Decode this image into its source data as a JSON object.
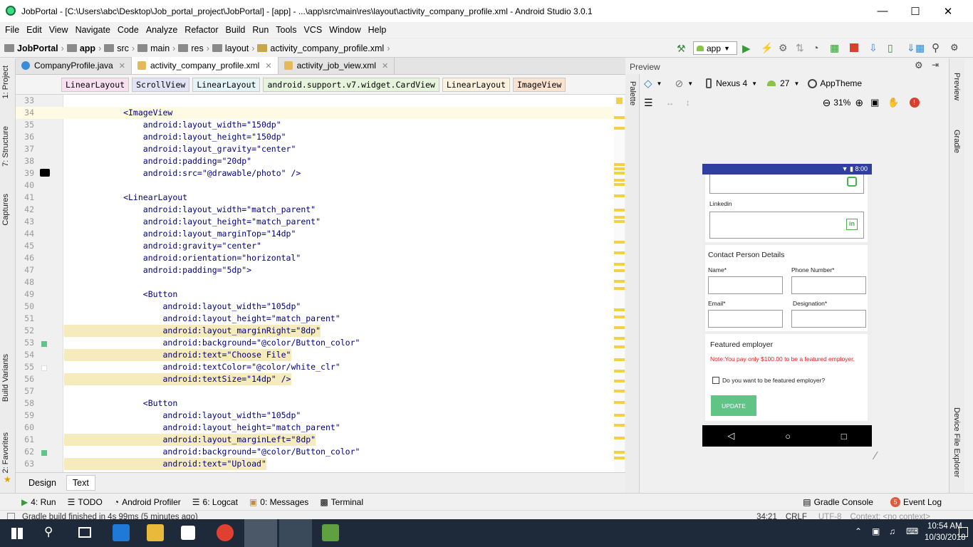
{
  "window": {
    "title": "JobPortal - [C:\\Users\\abc\\Desktop\\Job_portal_project\\JobPortal] - [app] - ...\\app\\src\\main\\res\\layout\\activity_company_profile.xml - Android Studio 3.0.1"
  },
  "menu": [
    "File",
    "Edit",
    "View",
    "Navigate",
    "Code",
    "Analyze",
    "Refactor",
    "Build",
    "Run",
    "Tools",
    "VCS",
    "Window",
    "Help"
  ],
  "breadcrumbs": [
    "JobPortal",
    "app",
    "src",
    "main",
    "res",
    "layout",
    "activity_company_profile.xml"
  ],
  "run_config": "app",
  "tabs": [
    {
      "label": "CompanyProfile.java"
    },
    {
      "label": "activity_company_profile.xml"
    },
    {
      "label": "activity_job_view.xml"
    }
  ],
  "component_path": [
    "LinearLayout",
    "ScrollView",
    "LinearLayout",
    "android.support.v7.widget.CardView",
    "LinearLayout",
    "ImageView"
  ],
  "code_lines": [
    {
      "n": "33",
      "text": ""
    },
    {
      "n": "34",
      "text": "            <ImageView"
    },
    {
      "n": "35",
      "text": "                android:layout_width=\"150dp\""
    },
    {
      "n": "36",
      "text": "                android:layout_height=\"150dp\""
    },
    {
      "n": "37",
      "text": "                android:layout_gravity=\"center\""
    },
    {
      "n": "38",
      "text": "                android:padding=\"20dp\""
    },
    {
      "n": "39",
      "text": "                android:src=\"@drawable/photo\" />"
    },
    {
      "n": "40",
      "text": ""
    },
    {
      "n": "41",
      "text": "            <LinearLayout"
    },
    {
      "n": "42",
      "text": "                android:layout_width=\"match_parent\""
    },
    {
      "n": "43",
      "text": "                android:layout_height=\"match_parent\""
    },
    {
      "n": "44",
      "text": "                android:layout_marginTop=\"14dp\""
    },
    {
      "n": "45",
      "text": "                android:gravity=\"center\""
    },
    {
      "n": "46",
      "text": "                android:orientation=\"horizontal\""
    },
    {
      "n": "47",
      "text": "                android:padding=\"5dp\">"
    },
    {
      "n": "48",
      "text": ""
    },
    {
      "n": "49",
      "text": "                <Button"
    },
    {
      "n": "50",
      "text": "                    android:layout_width=\"105dp\""
    },
    {
      "n": "51",
      "text": "                    android:layout_height=\"match_parent\""
    },
    {
      "n": "52",
      "text": "                    android:layout_marginRight=\"8dp\""
    },
    {
      "n": "53",
      "text": "                    android:background=\"@color/Button_color\""
    },
    {
      "n": "54",
      "text": "                    android:text=\"Choose File\""
    },
    {
      "n": "55",
      "text": "                    android:textColor=\"@color/white_clr\""
    },
    {
      "n": "56",
      "text": "                    android:textSize=\"14dp\" />"
    },
    {
      "n": "57",
      "text": ""
    },
    {
      "n": "58",
      "text": "                <Button"
    },
    {
      "n": "59",
      "text": "                    android:layout_width=\"105dp\""
    },
    {
      "n": "60",
      "text": "                    android:layout_height=\"match_parent\""
    },
    {
      "n": "61",
      "text": "                    android:layout_marginLeft=\"8dp\""
    },
    {
      "n": "62",
      "text": "                    android:background=\"@color/Button_color\""
    },
    {
      "n": "63",
      "text": "                    android:text=\"Upload\""
    }
  ],
  "design_tabs": [
    "Design",
    "Text"
  ],
  "preview": {
    "header": "Preview",
    "palette": "Palette",
    "device": "Nexus 4",
    "api": "27",
    "theme": "AppTheme",
    "zoom": "31%",
    "phone": {
      "clock": "8:00",
      "linkedin_label": "Linkedin",
      "contact_title": "Contact Person Details",
      "name_label": "Name*",
      "phone_label": "Phone Number*",
      "email_label": "Email*",
      "designation_label": "Designation*",
      "featured_title": "Featured employer",
      "note": "Note:You pay only $100.00 to be a featured employer.",
      "checkbox_label": "Do you want to be featured employer?",
      "update_button": "UPDATE"
    }
  },
  "left_tools": [
    "1: Project",
    "7: Structure",
    "Captures",
    "Build Variants",
    "2: Favorites"
  ],
  "right_tools": [
    "Preview",
    "Gradle",
    "Device File Explorer"
  ],
  "bottom_tools": [
    "4: Run",
    "TODO",
    "Android Profiler",
    "6: Logcat",
    "0: Messages",
    "Terminal"
  ],
  "bottom_right_tools": [
    "Gradle Console",
    "Event Log"
  ],
  "event_log_count": "5",
  "status": {
    "message": "Gradle build finished in 4s 99ms (5 minutes ago)",
    "position": "34:21",
    "line_sep": "CRLF",
    "encoding": "UTF-8",
    "context": "Context: <no context>"
  },
  "clock": {
    "time": "10:54 AM",
    "date": "10/30/2018"
  },
  "colors": {
    "accent": "#303f9f",
    "update_button": "#5fc486",
    "note_red": "#e02020",
    "warning": "#f2d14a"
  }
}
